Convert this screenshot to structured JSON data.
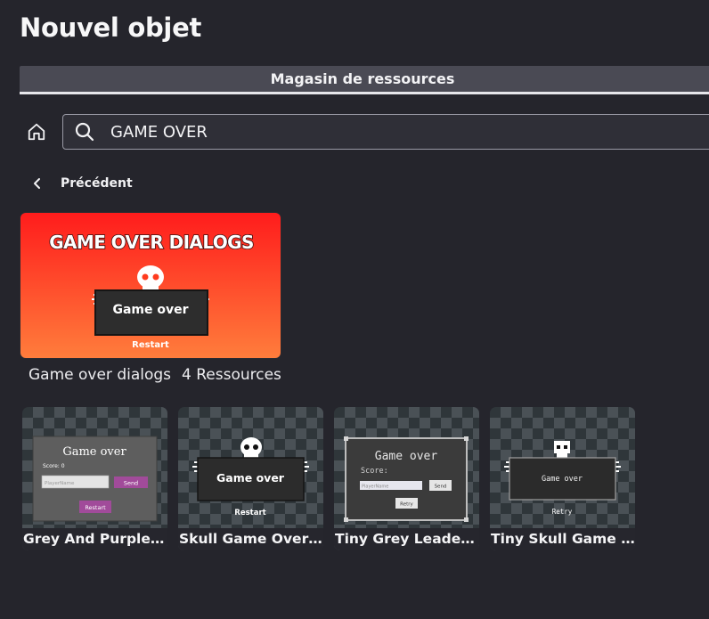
{
  "page": {
    "title": "Nouvel objet"
  },
  "tabs": [
    {
      "label": "Magasin de ressources",
      "active": true
    }
  ],
  "search": {
    "value": "GAME OVER",
    "placeholder": ""
  },
  "nav": {
    "back_label": "Précédent"
  },
  "pack": {
    "image_title": "GAME OVER DIALOGS",
    "image_panel": "Game over",
    "image_button": "Restart",
    "name": "Game over dialogs",
    "count_label": "4 Ressources"
  },
  "assets": [
    {
      "name": "Grey And Purple L...",
      "thumb": {
        "title": "Game over",
        "score": "Score: 0",
        "input_placeholder": "PlayerName",
        "send": "Send",
        "restart": "Restart"
      }
    },
    {
      "name": "Skull Game Over D...",
      "thumb": {
        "panel": "Game over",
        "button": "Restart"
      }
    },
    {
      "name": "Tiny Grey Leaderb...",
      "thumb": {
        "title": "Game over",
        "score": "Score:",
        "input_placeholder": "PlayerName",
        "send": "Send",
        "retry": "Retry"
      }
    },
    {
      "name": "Tiny Skull Game O...",
      "thumb": {
        "panel": "Game over",
        "button": "Retry"
      }
    }
  ],
  "colors": {
    "background": "#25252c",
    "tab_bar": "#4a4a54",
    "accent_purple": "#a14b9a",
    "gradient_top": "#ff1f1f",
    "gradient_bottom": "#ff7a3a"
  }
}
